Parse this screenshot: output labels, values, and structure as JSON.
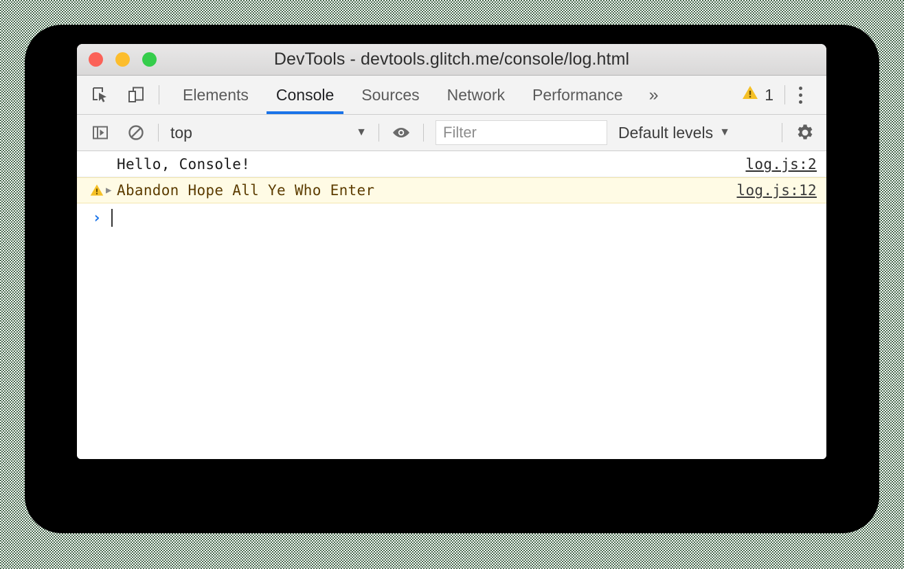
{
  "window": {
    "title": "DevTools - devtools.glitch.me/console/log.html",
    "traffic_lights": [
      {
        "name": "close",
        "color": "#fb6258"
      },
      {
        "name": "minimize",
        "color": "#fcbd2d"
      },
      {
        "name": "maximize",
        "color": "#35cd4b"
      }
    ]
  },
  "tabbar": {
    "left_icons": [
      {
        "name": "inspect-element-icon",
        "label": "Inspect element"
      },
      {
        "name": "device-toolbar-icon",
        "label": "Toggle device toolbar"
      }
    ],
    "tabs": [
      {
        "label": "Elements",
        "selected": false
      },
      {
        "label": "Console",
        "selected": true
      },
      {
        "label": "Sources",
        "selected": false
      },
      {
        "label": "Network",
        "selected": false
      },
      {
        "label": "Performance",
        "selected": false
      }
    ],
    "more_tabs_label": "»",
    "warning_count": "1",
    "warning_icon": "warning-triangle-icon",
    "menu_icon": "kebab-menu-icon",
    "accent_color": "#1a73e8",
    "warning_color": "#f5c026"
  },
  "console_toolbar": {
    "sidebar_toggle_icon": "console-sidebar-icon",
    "clear_icon": "clear-console-icon",
    "context_value": "top",
    "context_caret": "▼",
    "live_expression_icon": "eye-icon",
    "filter_placeholder": "Filter",
    "filter_value": "",
    "levels_label": "Default levels",
    "levels_caret": "▼",
    "settings_icon": "gear-icon"
  },
  "console": {
    "messages": [
      {
        "level": "log",
        "icon": "",
        "disclosure": "",
        "text": "Hello, Console!",
        "source": "log.js:2"
      },
      {
        "level": "warning",
        "icon": "warning-triangle-icon",
        "disclosure": "▶",
        "text": "Abandon Hope All Ye Who Enter",
        "source": "log.js:12"
      }
    ],
    "prompt_symbol": "›",
    "prompt_value": ""
  }
}
